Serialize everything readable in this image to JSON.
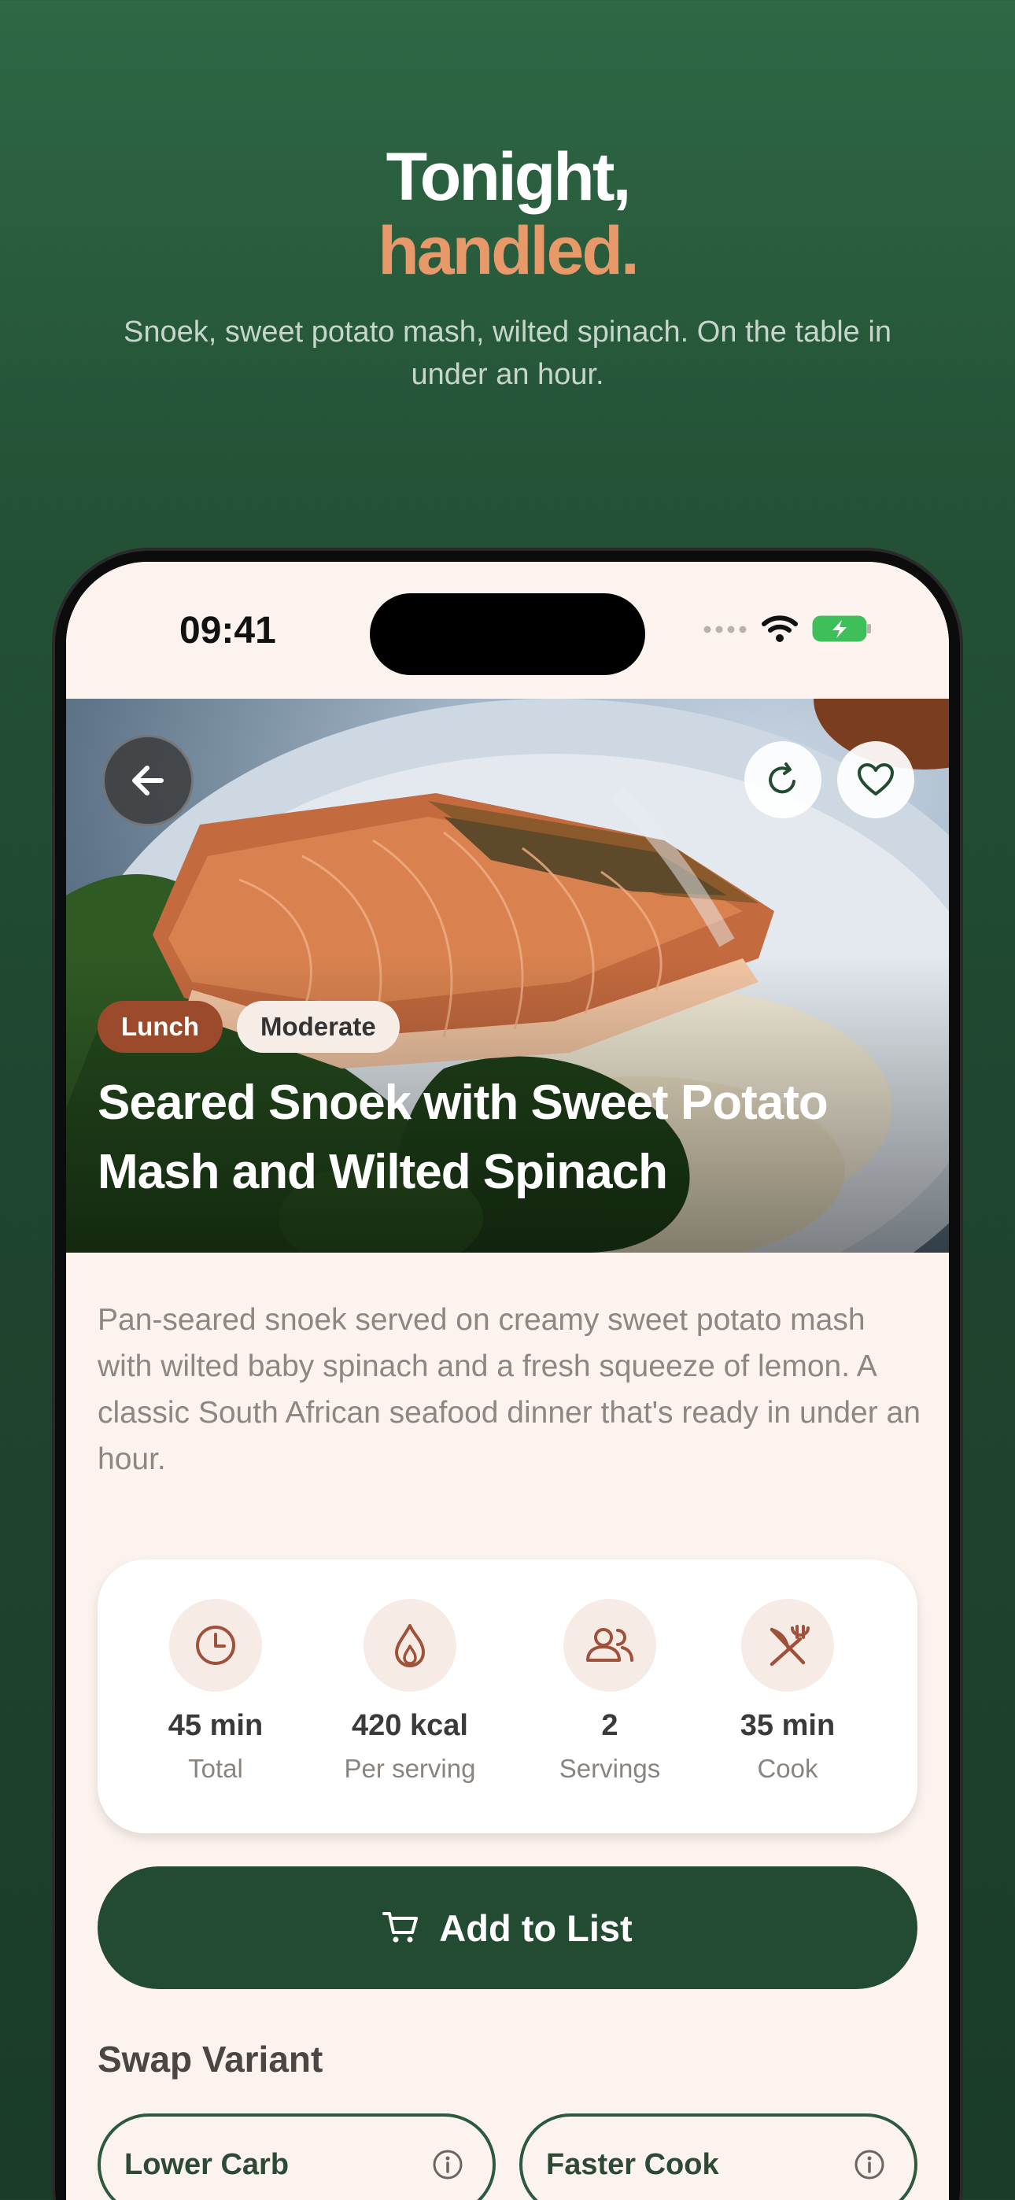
{
  "promo": {
    "headline_line1": "Tonight,",
    "headline_line2": "handled.",
    "subtitle": "Snoek, sweet potato mash, wilted spinach. On the table in under an hour."
  },
  "status_bar": {
    "time": "09:41"
  },
  "recipe": {
    "tags": [
      "Lunch",
      "Moderate"
    ],
    "title": "Seared Snoek with Sweet Potato Mash and Wilted Spinach",
    "description": "Pan-seared snoek served on creamy sweet potato mash with wilted baby spinach and a fresh squeeze of lemon. A classic South African seafood dinner that's ready in under an hour."
  },
  "stats": [
    {
      "icon": "clock-icon",
      "value": "45 min",
      "label": "Total"
    },
    {
      "icon": "flame-icon",
      "value": "420 kcal",
      "label": "Per serving"
    },
    {
      "icon": "people-icon",
      "value": "2",
      "label": "Servings"
    },
    {
      "icon": "utensils-icon",
      "value": "35 min",
      "label": "Cook"
    }
  ],
  "actions": {
    "add_to_list": "Add to List"
  },
  "swap": {
    "title": "Swap Variant",
    "variants": [
      "Lower Carb",
      "Faster Cook"
    ]
  },
  "colors": {
    "brand_green": "#234b31",
    "accent_orange": "#e8996a",
    "tag_rust": "#9c4a2c",
    "icon_rust": "#a0513a"
  }
}
